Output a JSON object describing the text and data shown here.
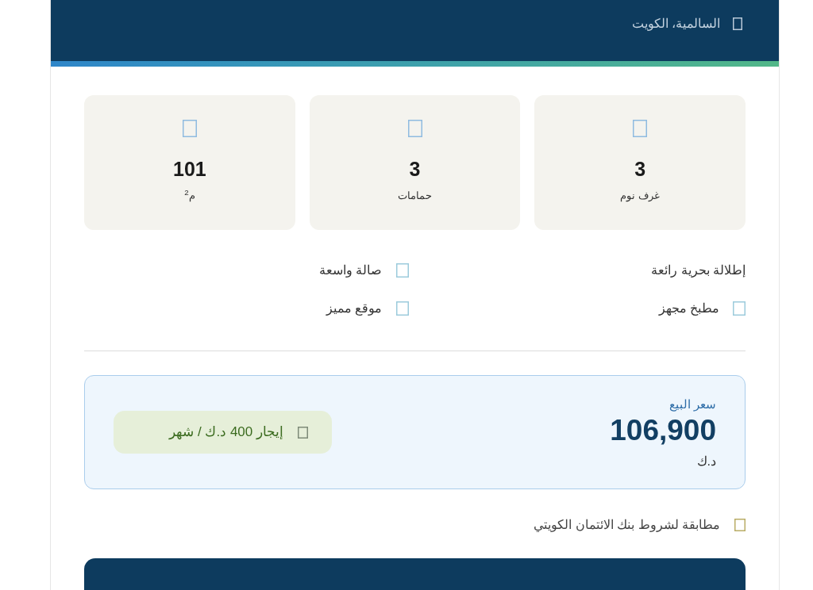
{
  "header": {
    "location": "السالمية، الكويت"
  },
  "stats": [
    {
      "value": "3",
      "label": "غرف نوم"
    },
    {
      "value": "3",
      "label": "حمامات"
    },
    {
      "value": "101",
      "label": "م$^{2}$"
    }
  ],
  "features": [
    {
      "label": "إطلالة بحرية رائعة",
      "icon": false
    },
    {
      "label": "صالة واسعة",
      "icon": true
    },
    {
      "label": "مطبخ مجهز",
      "icon": true
    },
    {
      "label": "موقع مميز",
      "icon": true
    }
  ],
  "price": {
    "label": "سعر البيع",
    "amount": "106,900",
    "currency": "د.ك"
  },
  "rent_badge": {
    "text": "إيجار 400 د.ك / شهر"
  },
  "compliance": {
    "text": "مطابقة لشروط بنك الائتمان الكويتي"
  }
}
